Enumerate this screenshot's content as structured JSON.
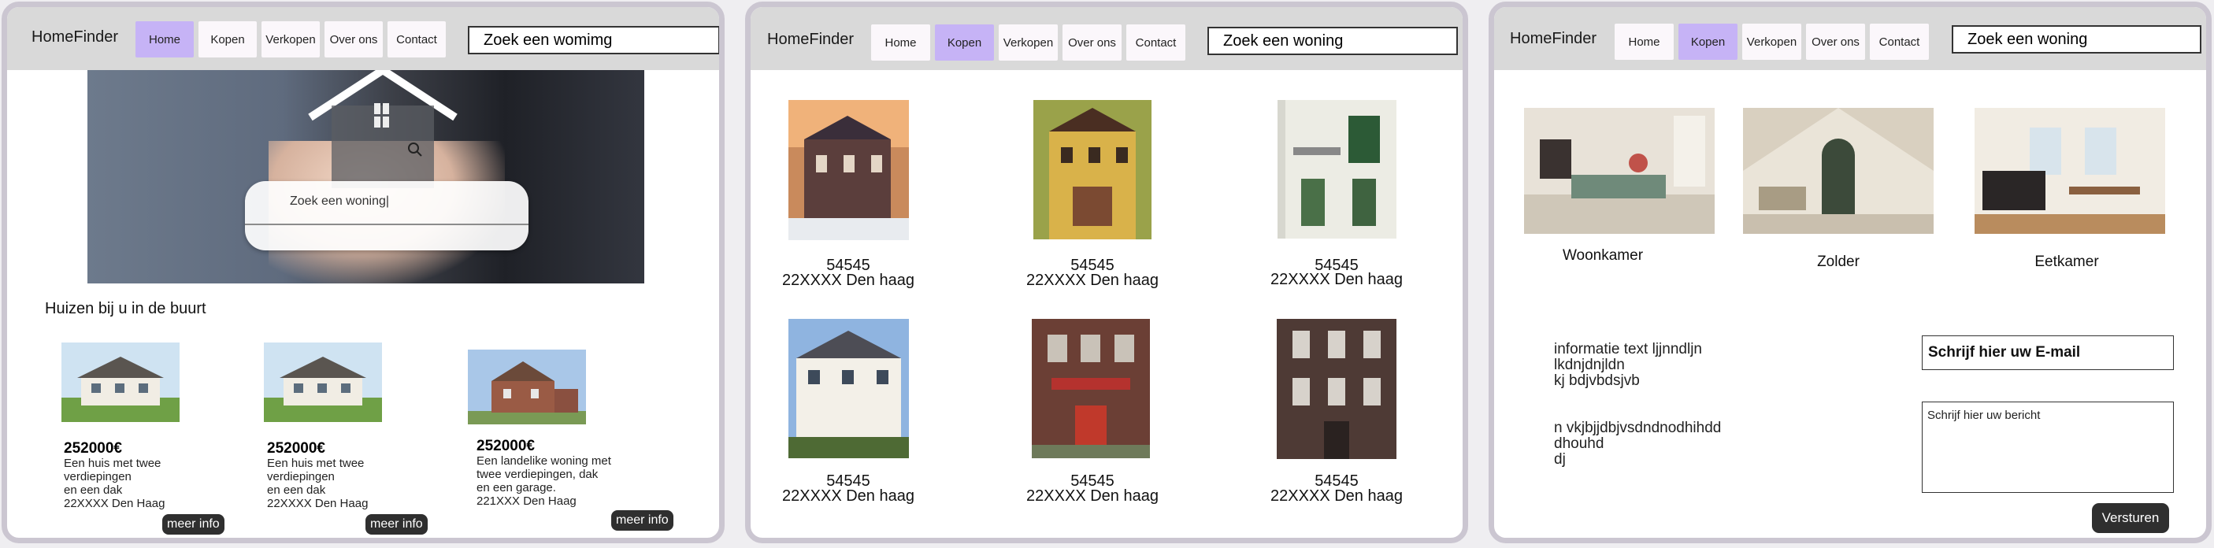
{
  "brand": "HomeFinder",
  "nav": [
    "Home",
    "Kopen",
    "Verkopen",
    "Over ons",
    "Contact"
  ],
  "panel1": {
    "active_tab": "Home",
    "search_value": "Zoek een womimg",
    "hero_search_value": "Zoek een woning|",
    "section_title": "Huizen bij u in de buurt",
    "cards": [
      {
        "price": "252000€",
        "desc": [
          "Een huis met twee",
          "verdiepingen",
          "en een dak",
          "22XXXX Den Haag"
        ],
        "button": "meer info"
      },
      {
        "price": "252000€",
        "desc": [
          "Een huis met twee",
          "verdiepingen",
          "en een dak",
          "22XXXX Den Haag"
        ],
        "button": "meer info"
      },
      {
        "price": "252000€",
        "desc": [
          "Een landelike woning met",
          "twee verdiepingen, dak",
          "en een garage.",
          "221XXX Den Haag"
        ],
        "button": "meer info"
      }
    ]
  },
  "panel2": {
    "active_tab": "Kopen",
    "search_value": "Zoek een woning",
    "listings": [
      {
        "number": "54545",
        "address": "22XXXX Den haag"
      },
      {
        "number": "54545",
        "address": "22XXXX Den haag"
      },
      {
        "number": "54545",
        "address": "22XXXX Den haag"
      },
      {
        "number": "54545",
        "address": "22XXXX Den haag"
      },
      {
        "number": "54545",
        "address": "22XXXX Den haag"
      },
      {
        "number": "54545",
        "address": "22XXXX Den haag"
      }
    ]
  },
  "panel3": {
    "active_tab": "Kopen",
    "search_value": "Zoek een woning",
    "rooms": [
      "Woonkamer",
      "Zolder",
      "Eetkamer"
    ],
    "info_block_1": [
      "informatie text ljjnndljn",
      "lkdnjdnjldn",
      "kj bdjvbdsjvb"
    ],
    "info_block_2": [
      "n vkjbjjdbjvsdndnodhihdd",
      "dhouhd",
      "dj"
    ],
    "email_placeholder": "Schrijf hier uw E-mail",
    "message_placeholder": "Schrijf hier uw bericht",
    "send_button": "Versturen"
  },
  "colors": {
    "nav_active": "#c6b3f6",
    "header_bg": "#d9d9d9",
    "panel_border": "#cbc6d1",
    "button_dark": "#2f2f2f"
  }
}
